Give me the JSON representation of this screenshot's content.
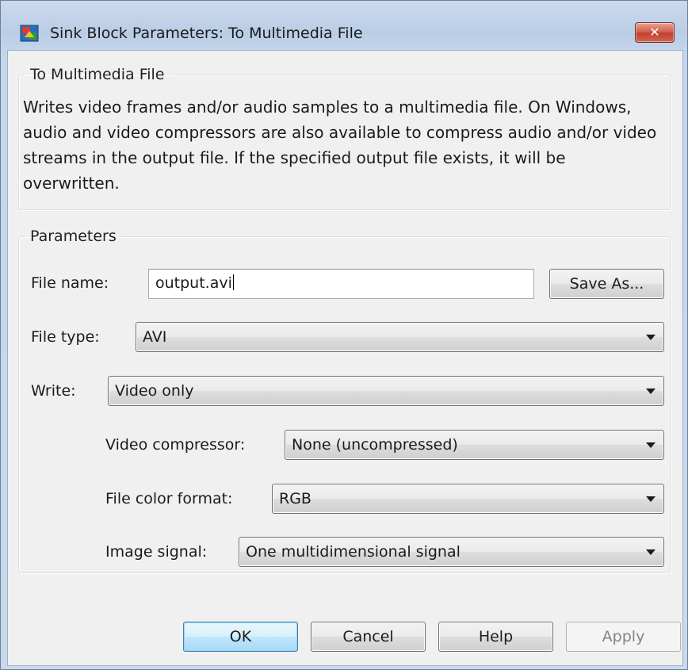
{
  "window": {
    "title": "Sink Block Parameters: To Multimedia File",
    "close_glyph": "✕"
  },
  "block_group": {
    "legend": "To Multimedia File",
    "description": "Writes video frames and/or audio samples to a multimedia file. On Windows, audio and video compressors are also available to compress audio and/or video streams in the output file. If the specified output file exists, it will be overwritten."
  },
  "params_group": {
    "legend": "Parameters",
    "file_name_label": "File name:",
    "file_name_value": "output.avi",
    "save_as_label": "Save As...",
    "file_type_label": "File type:",
    "file_type_value": "AVI",
    "write_label": "Write:",
    "write_value": "Video only",
    "video_compressor_label": "Video compressor:",
    "video_compressor_value": "None (uncompressed)",
    "file_color_format_label": "File color format:",
    "file_color_format_value": "RGB",
    "image_signal_label": "Image signal:",
    "image_signal_value": "One multidimensional signal"
  },
  "buttons": {
    "ok": "OK",
    "cancel": "Cancel",
    "help": "Help",
    "apply": "Apply"
  },
  "icons": {
    "app": "simulink-block-icon",
    "dropdown": "chevron-down-icon"
  }
}
